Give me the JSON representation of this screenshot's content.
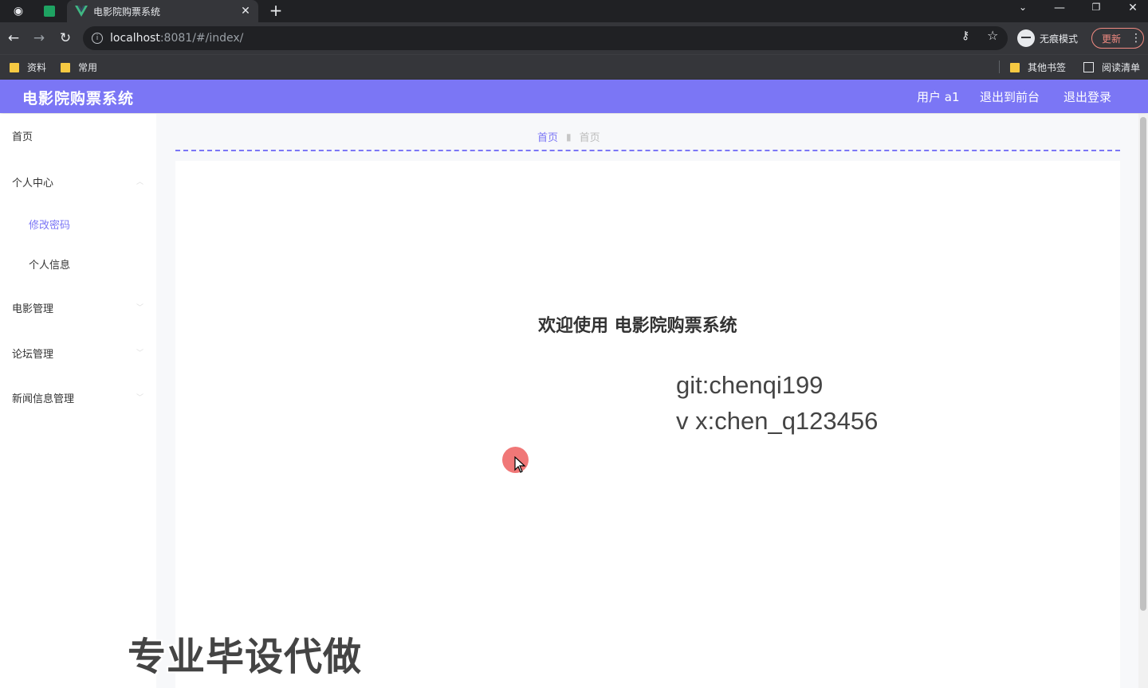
{
  "browser": {
    "tab_title": "电影院购票系统",
    "tab_close": "✕",
    "new_tab": "+",
    "url_host": "localhost",
    "url_rest": ":8081/#/index/",
    "incognito_label": "无痕模式",
    "update_label": "更新",
    "bookmarks": [
      "资料",
      "常用"
    ],
    "other_bookmarks": "其他书签",
    "reading_list": "阅读清单"
  },
  "header": {
    "title": "电影院购票系统",
    "user": "用户 a1",
    "back_to_front": "退出到前台",
    "logout": "退出登录"
  },
  "sidebar": {
    "home": "首页",
    "personal_center": "个人中心",
    "change_password": "修改密码",
    "personal_info": "个人信息",
    "movie_mgmt": "电影管理",
    "forum_mgmt": "论坛管理",
    "news_mgmt": "新闻信息管理"
  },
  "breadcrumb": {
    "level1": "首页",
    "level2": "首页"
  },
  "main": {
    "welcome": "欢迎使用 电影院购票系统",
    "git": "git:chenqi199",
    "vx": "v x:chen_q123456"
  },
  "overlay": {
    "watermark": "专业毕设代做"
  },
  "colors": {
    "accent": "#7b76f5",
    "chrome_dark": "#202124",
    "chrome_mid": "#35363a"
  }
}
